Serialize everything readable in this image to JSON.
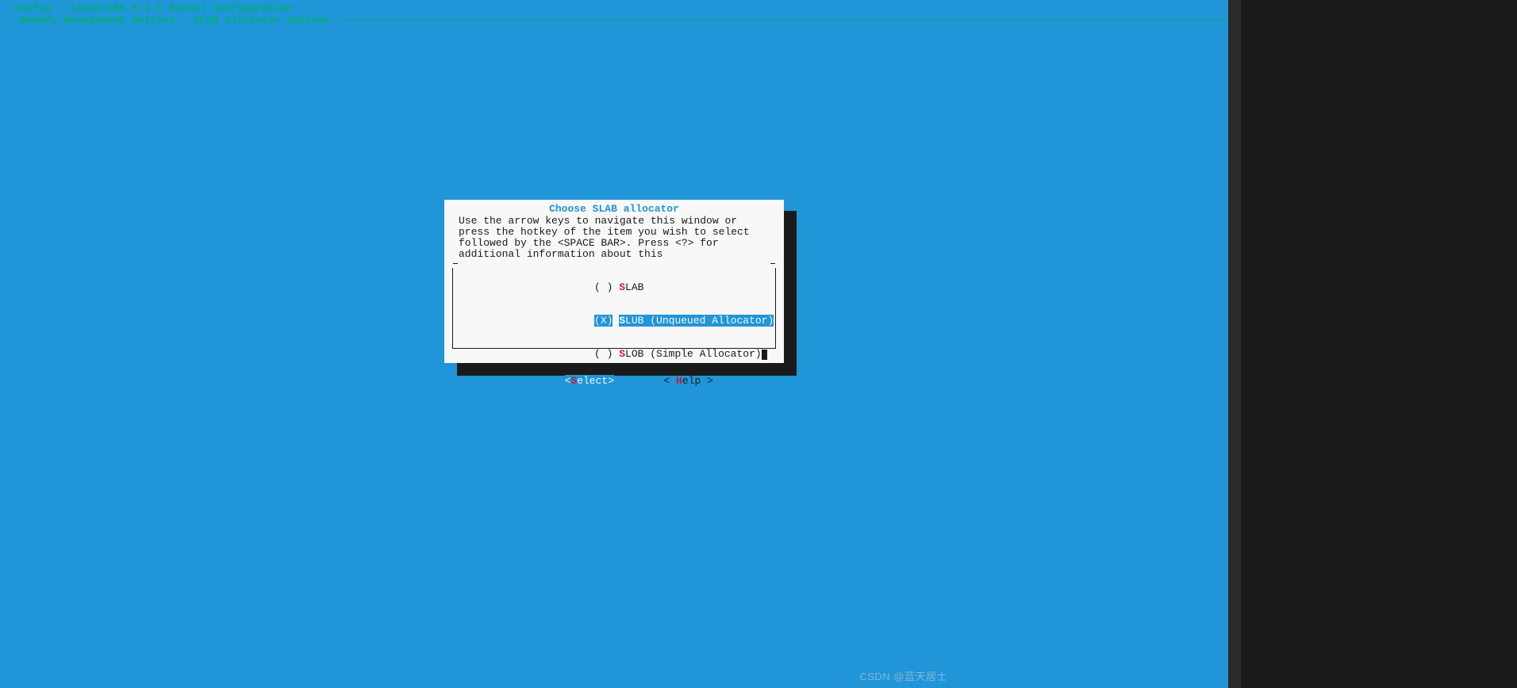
{
  "header": {
    "title": ".config - Linux/x86 6.1.0 Kernel Configuration"
  },
  "breadcrumb": {
    "path": "→ Memory Management options → SLAB allocator options"
  },
  "dialog": {
    "title": "Choose SLAB allocator",
    "help_text": "Use the arrow keys to navigate this window or press the hotkey of the item you wish to select followed by the <SPACE BAR>. Press <?> for additional information about this",
    "options": [
      {
        "mark": "( )",
        "hotkey": "S",
        "rest": "LAB",
        "selected": false
      },
      {
        "mark": "(X)",
        "hotkey": "S",
        "rest": "LUB (Unqueued Allocator)",
        "selected": true
      },
      {
        "mark": "( )",
        "hotkey": "S",
        "rest": "LOB (Simple Allocator)",
        "selected": false
      }
    ],
    "buttons": {
      "select": {
        "open": "<",
        "hot": "S",
        "rest": "elect>",
        "active": true
      },
      "help": {
        "open": "< ",
        "hot": "H",
        "rest": "elp >",
        "active": false
      }
    }
  },
  "watermark": "CSDN @蓝天居士"
}
